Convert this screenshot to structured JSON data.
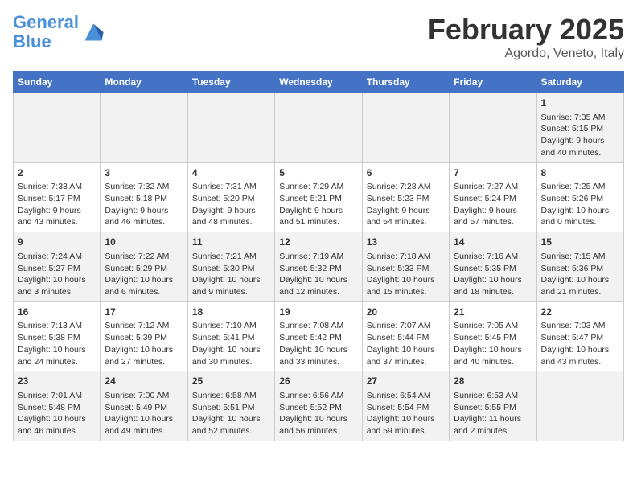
{
  "header": {
    "logo_line1": "General",
    "logo_line2": "Blue",
    "month": "February 2025",
    "location": "Agordo, Veneto, Italy"
  },
  "weekdays": [
    "Sunday",
    "Monday",
    "Tuesday",
    "Wednesday",
    "Thursday",
    "Friday",
    "Saturday"
  ],
  "weeks": [
    [
      {
        "day": "",
        "text": ""
      },
      {
        "day": "",
        "text": ""
      },
      {
        "day": "",
        "text": ""
      },
      {
        "day": "",
        "text": ""
      },
      {
        "day": "",
        "text": ""
      },
      {
        "day": "",
        "text": ""
      },
      {
        "day": "1",
        "text": "Sunrise: 7:35 AM\nSunset: 5:15 PM\nDaylight: 9 hours and 40 minutes."
      }
    ],
    [
      {
        "day": "2",
        "text": "Sunrise: 7:33 AM\nSunset: 5:17 PM\nDaylight: 9 hours and 43 minutes."
      },
      {
        "day": "3",
        "text": "Sunrise: 7:32 AM\nSunset: 5:18 PM\nDaylight: 9 hours and 46 minutes."
      },
      {
        "day": "4",
        "text": "Sunrise: 7:31 AM\nSunset: 5:20 PM\nDaylight: 9 hours and 48 minutes."
      },
      {
        "day": "5",
        "text": "Sunrise: 7:29 AM\nSunset: 5:21 PM\nDaylight: 9 hours and 51 minutes."
      },
      {
        "day": "6",
        "text": "Sunrise: 7:28 AM\nSunset: 5:23 PM\nDaylight: 9 hours and 54 minutes."
      },
      {
        "day": "7",
        "text": "Sunrise: 7:27 AM\nSunset: 5:24 PM\nDaylight: 9 hours and 57 minutes."
      },
      {
        "day": "8",
        "text": "Sunrise: 7:25 AM\nSunset: 5:26 PM\nDaylight: 10 hours and 0 minutes."
      }
    ],
    [
      {
        "day": "9",
        "text": "Sunrise: 7:24 AM\nSunset: 5:27 PM\nDaylight: 10 hours and 3 minutes."
      },
      {
        "day": "10",
        "text": "Sunrise: 7:22 AM\nSunset: 5:29 PM\nDaylight: 10 hours and 6 minutes."
      },
      {
        "day": "11",
        "text": "Sunrise: 7:21 AM\nSunset: 5:30 PM\nDaylight: 10 hours and 9 minutes."
      },
      {
        "day": "12",
        "text": "Sunrise: 7:19 AM\nSunset: 5:32 PM\nDaylight: 10 hours and 12 minutes."
      },
      {
        "day": "13",
        "text": "Sunrise: 7:18 AM\nSunset: 5:33 PM\nDaylight: 10 hours and 15 minutes."
      },
      {
        "day": "14",
        "text": "Sunrise: 7:16 AM\nSunset: 5:35 PM\nDaylight: 10 hours and 18 minutes."
      },
      {
        "day": "15",
        "text": "Sunrise: 7:15 AM\nSunset: 5:36 PM\nDaylight: 10 hours and 21 minutes."
      }
    ],
    [
      {
        "day": "16",
        "text": "Sunrise: 7:13 AM\nSunset: 5:38 PM\nDaylight: 10 hours and 24 minutes."
      },
      {
        "day": "17",
        "text": "Sunrise: 7:12 AM\nSunset: 5:39 PM\nDaylight: 10 hours and 27 minutes."
      },
      {
        "day": "18",
        "text": "Sunrise: 7:10 AM\nSunset: 5:41 PM\nDaylight: 10 hours and 30 minutes."
      },
      {
        "day": "19",
        "text": "Sunrise: 7:08 AM\nSunset: 5:42 PM\nDaylight: 10 hours and 33 minutes."
      },
      {
        "day": "20",
        "text": "Sunrise: 7:07 AM\nSunset: 5:44 PM\nDaylight: 10 hours and 37 minutes."
      },
      {
        "day": "21",
        "text": "Sunrise: 7:05 AM\nSunset: 5:45 PM\nDaylight: 10 hours and 40 minutes."
      },
      {
        "day": "22",
        "text": "Sunrise: 7:03 AM\nSunset: 5:47 PM\nDaylight: 10 hours and 43 minutes."
      }
    ],
    [
      {
        "day": "23",
        "text": "Sunrise: 7:01 AM\nSunset: 5:48 PM\nDaylight: 10 hours and 46 minutes."
      },
      {
        "day": "24",
        "text": "Sunrise: 7:00 AM\nSunset: 5:49 PM\nDaylight: 10 hours and 49 minutes."
      },
      {
        "day": "25",
        "text": "Sunrise: 6:58 AM\nSunset: 5:51 PM\nDaylight: 10 hours and 52 minutes."
      },
      {
        "day": "26",
        "text": "Sunrise: 6:56 AM\nSunset: 5:52 PM\nDaylight: 10 hours and 56 minutes."
      },
      {
        "day": "27",
        "text": "Sunrise: 6:54 AM\nSunset: 5:54 PM\nDaylight: 10 hours and 59 minutes."
      },
      {
        "day": "28",
        "text": "Sunrise: 6:53 AM\nSunset: 5:55 PM\nDaylight: 11 hours and 2 minutes."
      },
      {
        "day": "",
        "text": ""
      }
    ]
  ]
}
